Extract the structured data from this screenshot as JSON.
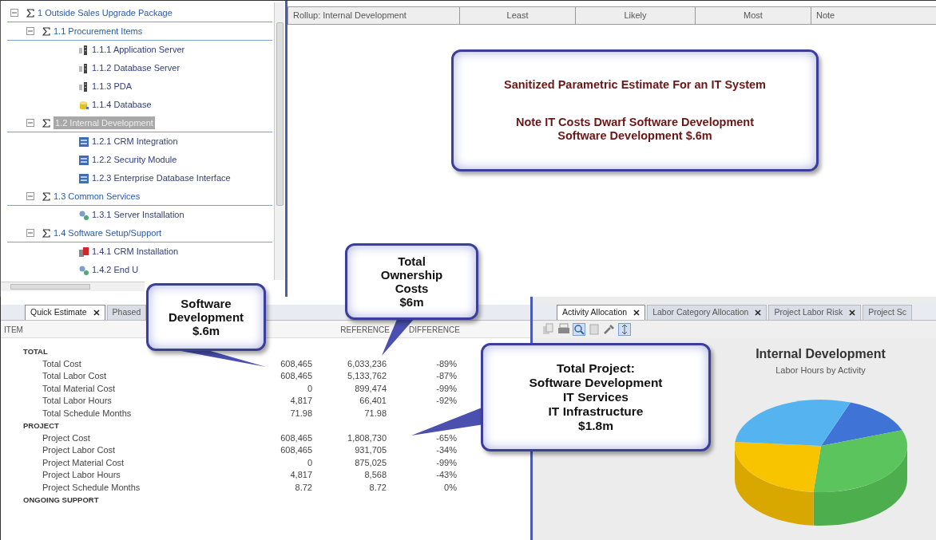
{
  "tree": [
    {
      "label": "1 Outside Sales Upgrade Package",
      "kind": "group",
      "expanded": true,
      "selected": false,
      "children": [
        {
          "label": "1.1 Procurement Items",
          "kind": "group",
          "expanded": true,
          "selected": false,
          "children": [
            {
              "label": "1.1.1 Application Server",
              "kind": "server",
              "selected": false
            },
            {
              "label": "1.1.2 Database Server",
              "kind": "server",
              "selected": false
            },
            {
              "label": "1.1.3 PDA",
              "kind": "server",
              "selected": false
            },
            {
              "label": "1.1.4 Database",
              "kind": "database",
              "selected": false
            }
          ]
        },
        {
          "label": "1.2 Internal Development",
          "kind": "group",
          "expanded": true,
          "selected": true,
          "children": [
            {
              "label": "1.2.1 CRM Integration",
              "kind": "module",
              "selected": false
            },
            {
              "label": "1.2.2 Security Module",
              "kind": "module",
              "selected": false
            },
            {
              "label": "1.2.3 Enterprise Database Interface",
              "kind": "module",
              "selected": false
            }
          ]
        },
        {
          "label": "1.3 Common Services",
          "kind": "group",
          "expanded": true,
          "selected": false,
          "children": [
            {
              "label": "1.3.1 Server Installation",
              "kind": "service",
              "selected": false
            }
          ]
        },
        {
          "label": "1.4 Software Setup/Support",
          "kind": "group",
          "expanded": true,
          "selected": false,
          "children": [
            {
              "label": "1.4.1 CRM Installation",
              "kind": "install",
              "selected": false
            },
            {
              "label": "1.4.2 End U",
              "kind": "service",
              "selected": false
            }
          ]
        }
      ]
    }
  ],
  "rollup": {
    "columns": [
      "Rollup: Internal Development",
      "Least",
      "Likely",
      "Most",
      "Note"
    ]
  },
  "estimate": {
    "tabs": [
      {
        "label": "Quick Estimate",
        "selected": true
      },
      {
        "label": "Phased",
        "selected": false
      }
    ],
    "columns": {
      "item": "ITEM",
      "reference": "REFERENCE",
      "difference": "DIFFERENCE"
    },
    "rows": [
      {
        "kind": "section",
        "item": "TOTAL"
      },
      {
        "kind": "row",
        "item": "Total Cost",
        "column_2": "608,465",
        "reference": "6,033,236",
        "difference": "-89%"
      },
      {
        "kind": "row",
        "item": "Total Labor Cost",
        "column_2": "608,465",
        "reference": "5,133,762",
        "difference": "-87%"
      },
      {
        "kind": "row",
        "item": "Total Material Cost",
        "column_2": "0",
        "reference": "899,474",
        "difference": "-99%"
      },
      {
        "kind": "row",
        "item": "Total Labor Hours",
        "column_2": "4,817",
        "reference": "66,401",
        "difference": "-92%"
      },
      {
        "kind": "row",
        "item": "Total Schedule Months",
        "column_2": "71.98",
        "reference": "71.98"
      },
      {
        "kind": "section",
        "item": "PROJECT"
      },
      {
        "kind": "row",
        "item": "Project Cost",
        "column_2": "608,465",
        "reference": "1,808,730",
        "difference": "-65%"
      },
      {
        "kind": "row",
        "item": "Project Labor Cost",
        "column_2": "608,465",
        "reference": "931,705",
        "difference": "-34%"
      },
      {
        "kind": "row",
        "item": "Project Material Cost",
        "column_2": "0",
        "reference": "875,025",
        "difference": "-99%"
      },
      {
        "kind": "row",
        "item": "Project Labor Hours",
        "column_2": "4,817",
        "reference": "8,568",
        "difference": "-43%"
      },
      {
        "kind": "row",
        "item": "Project Schedule Months",
        "column_2": "8.72",
        "reference": "8.72",
        "difference": "0%"
      },
      {
        "kind": "section",
        "item": "ONGOING SUPPORT"
      }
    ]
  },
  "analysis": {
    "tabs": [
      {
        "label": "Activity Allocation",
        "selected": true
      },
      {
        "label": "Labor Category Allocation",
        "selected": false
      },
      {
        "label": "Project Labor Risk",
        "selected": false
      },
      {
        "label": "Project Sc",
        "selected": false
      }
    ],
    "chart_title": "Internal Development",
    "chart_subtitle": "Labor Hours by Activity"
  },
  "callouts": [
    {
      "lines": [
        "Sanitized Parametric Estimate For an IT System",
        "Note IT Costs Dwarf Software Development",
        "Software Development $.6m"
      ]
    },
    {
      "lines": [
        "Software",
        "Development",
        "$.6m"
      ]
    },
    {
      "lines": [
        "Total",
        "Ownership",
        "Costs",
        "$6m"
      ]
    },
    {
      "lines": [
        "Total Project:",
        "Software Development",
        "IT Services",
        "IT Infrastructure",
        "$1.8m"
      ]
    }
  ]
}
